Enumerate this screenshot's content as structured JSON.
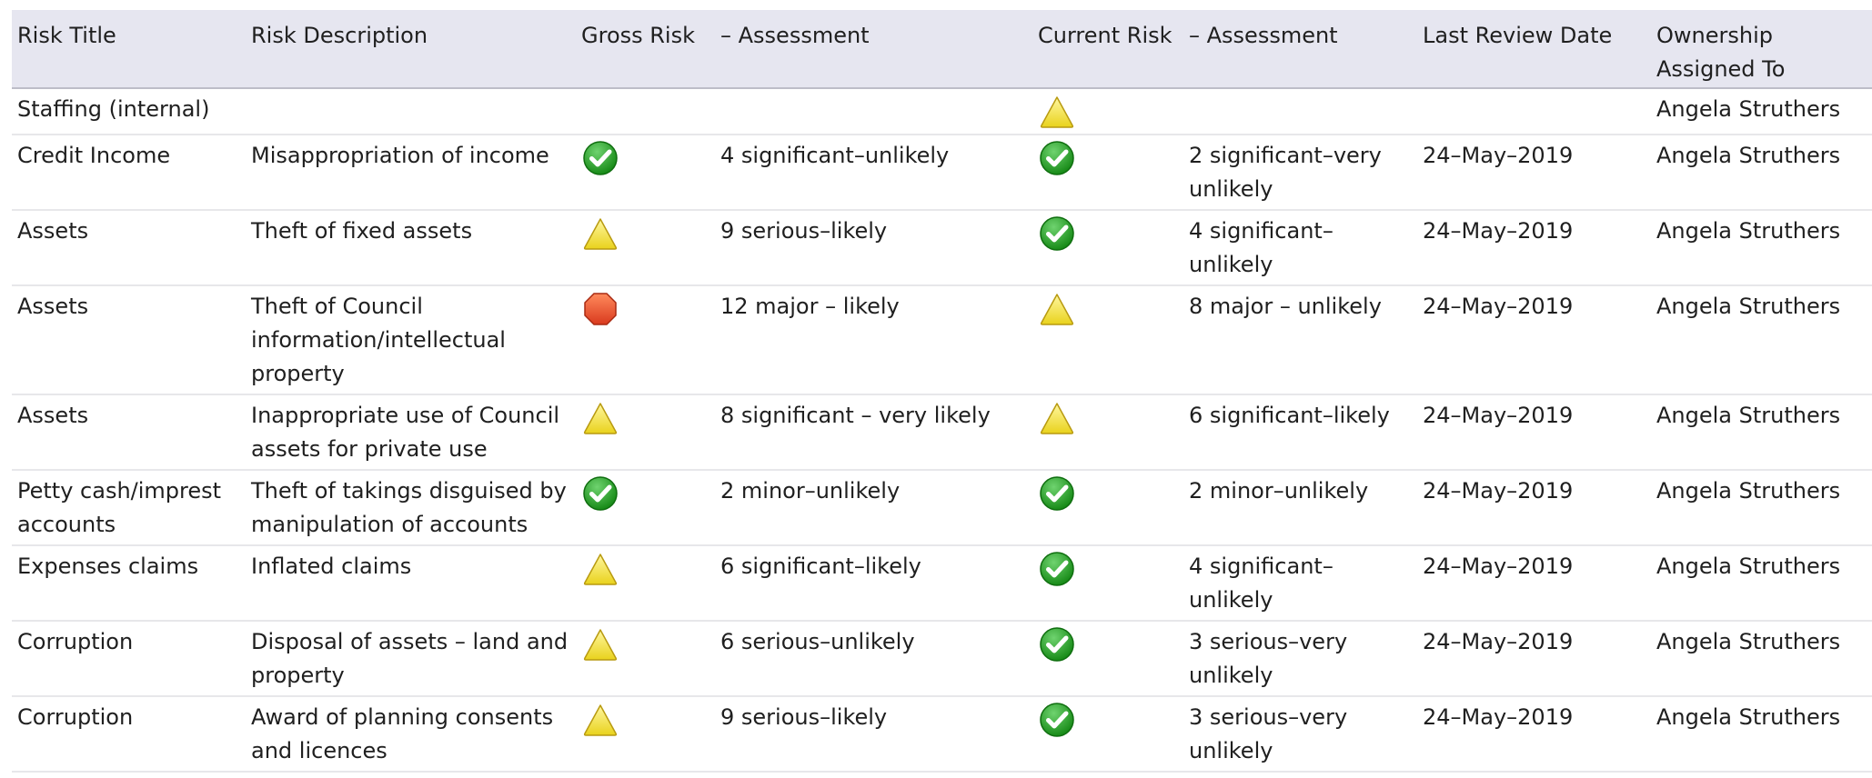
{
  "columns": [
    "Risk Title",
    "Risk Description",
    "Gross Risk",
    "–  Assessment",
    "Current Risk",
    "– Assessment",
    "Last Review Date",
    "Ownership Assigned To"
  ],
  "rows": [
    {
      "title": "Staffing (internal)",
      "description": "",
      "gross_icon": "",
      "gross_assessment": "",
      "current_icon": "warning-icon",
      "current_assessment": "",
      "review_date": "",
      "owner": "Angela Struthers"
    },
    {
      "title": "Credit Income",
      "description": "Misappropriation of income",
      "gross_icon": "check-icon",
      "gross_assessment": "4 significant–unlikely",
      "current_icon": "check-icon",
      "current_assessment": "2 significant–very unlikely",
      "review_date": "24–May–2019",
      "owner": "Angela Struthers"
    },
    {
      "title": "Assets",
      "description": "Theft of fixed assets",
      "gross_icon": "warning-icon",
      "gross_assessment": "9 serious–likely",
      "current_icon": "check-icon",
      "current_assessment": "4 significant– unlikely",
      "review_date": "24–May–2019",
      "owner": "Angela Struthers"
    },
    {
      "title": "Assets",
      "description": "Theft of Council information/intellectual property",
      "gross_icon": "stop-icon",
      "gross_assessment": "12 major – likely",
      "current_icon": "warning-icon",
      "current_assessment": "8 major – unlikely",
      "review_date": "24–May–2019",
      "owner": "Angela Struthers"
    },
    {
      "title": "Assets",
      "description": "Inappropriate use of Council assets for private use",
      "gross_icon": "warning-icon",
      "gross_assessment": "8 significant – very likely",
      "current_icon": "warning-icon",
      "current_assessment": "6 significant–likely",
      "review_date": "24–May–2019",
      "owner": "Angela Struthers"
    },
    {
      "title": "Petty cash/imprest accounts",
      "description": "Theft of takings disguised by manipulation of accounts",
      "gross_icon": "check-icon",
      "gross_assessment": "2 minor–unlikely",
      "current_icon": "check-icon",
      "current_assessment": "2 minor–unlikely",
      "review_date": "24–May–2019",
      "owner": "Angela Struthers"
    },
    {
      "title": "Expenses claims",
      "description": "Inflated claims",
      "gross_icon": "warning-icon",
      "gross_assessment": "6 significant–likely",
      "current_icon": "check-icon",
      "current_assessment": "4 significant– unlikely",
      "review_date": "24–May–2019",
      "owner": "Angela Struthers"
    },
    {
      "title": "Corruption",
      "description": "Disposal of assets – land and property",
      "gross_icon": "warning-icon",
      "gross_assessment": "6 serious–unlikely",
      "current_icon": "check-icon",
      "current_assessment": "3 serious–very unlikely",
      "review_date": "24–May–2019",
      "owner": "Angela Struthers"
    },
    {
      "title": "Corruption",
      "description": "Award of planning consents and licences",
      "gross_icon": "warning-icon",
      "gross_assessment": "9 serious–likely",
      "current_icon": "check-icon",
      "current_assessment": "3 serious–very unlikely",
      "review_date": "24–May–2019",
      "owner": "Angela Struthers"
    }
  ],
  "colors": {
    "header_bg": "#e6e6f0",
    "check_green": "#2fa72f",
    "warning_yellow": "#f2e33a",
    "stop_red": "#e84a2a"
  }
}
